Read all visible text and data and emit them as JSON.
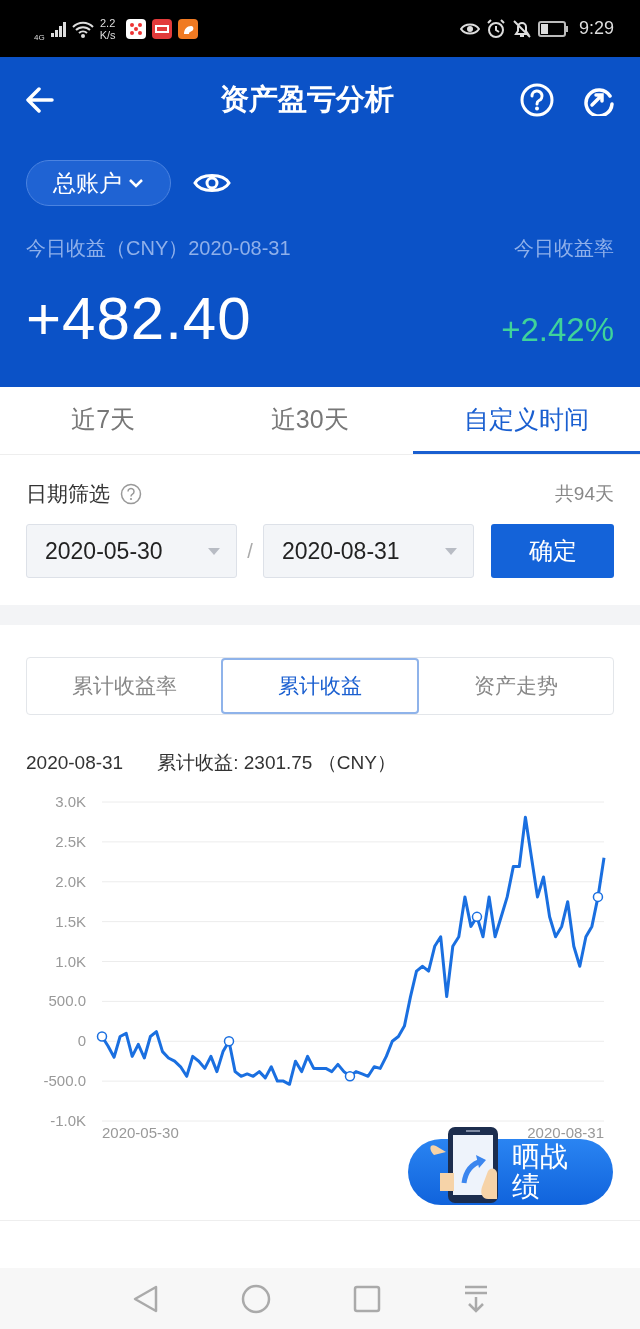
{
  "status_bar": {
    "network": "4G",
    "speed": "2.2",
    "speed_unit": "K/s",
    "time": "9:29"
  },
  "header": {
    "title": "资产盈亏分析",
    "account": "总账户",
    "today_label": "今日收益（CNY）2020-08-31",
    "today_rate_label": "今日收益率",
    "today_value": "+482.40",
    "today_rate": "+2.42%"
  },
  "tabs": [
    {
      "label": "近7天",
      "selected": false
    },
    {
      "label": "近30天",
      "selected": false
    },
    {
      "label": "自定义时间",
      "selected": true
    }
  ],
  "date_filter": {
    "label": "日期筛选",
    "days": "共94天",
    "start": "2020-05-30",
    "separator": "/",
    "end": "2020-08-31",
    "confirm": "确定"
  },
  "chart_tabs": [
    {
      "label": "累计收益率",
      "selected": false
    },
    {
      "label": "累计收益",
      "selected": true
    },
    {
      "label": "资产走势",
      "selected": false
    }
  ],
  "chart_info": {
    "date": "2020-08-31",
    "summary": "累计收益: 2301.75 （CNY）"
  },
  "chart_axis": {
    "start_date": "2020-05-30",
    "end_date": "2020-08-31"
  },
  "chart_data": {
    "type": "line",
    "grid": true,
    "ylim": [
      -1000,
      3000
    ],
    "yticks": [
      {
        "value": 3000,
        "label": "3.0K"
      },
      {
        "value": 2500,
        "label": "2.5K"
      },
      {
        "value": 2000,
        "label": "2.0K"
      },
      {
        "value": 1500,
        "label": "1.5K"
      },
      {
        "value": 1000,
        "label": "1.0K"
      },
      {
        "value": 500,
        "label": "500.0"
      },
      {
        "value": 0,
        "label": "0"
      },
      {
        "value": -500,
        "label": "-500.0"
      },
      {
        "value": -1000,
        "label": "-1.0K"
      }
    ],
    "series": [
      {
        "color": "#1a6fe0",
        "values": [
          60,
          -60,
          -200,
          60,
          100,
          -190,
          -40,
          -210,
          60,
          120,
          -130,
          -210,
          -250,
          -320,
          -440,
          -190,
          -250,
          -340,
          -190,
          -380,
          -130,
          0,
          -380,
          -440,
          -410,
          -440,
          -380,
          -460,
          -320,
          -500,
          -500,
          -540,
          -250,
          -380,
          -190,
          -340,
          -340,
          -340,
          -380,
          -290,
          -380,
          -440,
          -380,
          -410,
          -440,
          -320,
          -340,
          -190,
          0,
          60,
          190,
          560,
          880,
          940,
          880,
          1190,
          1310,
          560,
          1190,
          1310,
          1810,
          1440,
          1560,
          1310,
          1810,
          1310,
          1560,
          1810,
          2190,
          2190,
          2810,
          2310,
          1810,
          2060,
          1560,
          1310,
          1440,
          1750,
          1190,
          940,
          1310,
          1440,
          1810,
          2300
        ]
      }
    ]
  },
  "share_button": {
    "label": "晒战绩"
  }
}
